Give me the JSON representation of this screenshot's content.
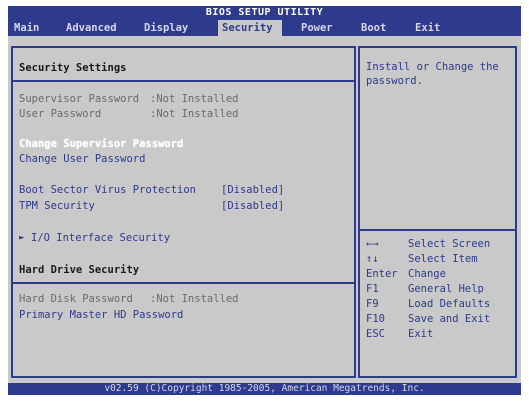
{
  "title": "BIOS SETUP UTILITY",
  "menu": [
    "Main",
    "Advanced",
    "Display",
    "Security",
    "Power",
    "Boot",
    "Exit"
  ],
  "active_menu": "Security",
  "left": {
    "heading": "Security Settings",
    "supervisor_password_label": "Supervisor Password",
    "supervisor_password_value": ":Not Installed",
    "user_password_label": "User Password",
    "user_password_value": ":Not Installed",
    "change_supervisor_password": "Change Supervisor Password",
    "change_user_password": "Change User Password",
    "boot_sector_virus_protection_label": "Boot Sector Virus Protection",
    "boot_sector_virus_protection_value": "[Disabled]",
    "tpm_security_label": "TPM Security",
    "tpm_security_value": "[Disabled]",
    "io_interface_security_marker": "►",
    "io_interface_security": "I/O Interface Security",
    "hard_drive_heading": "Hard Drive Security",
    "hard_disk_password_label": "Hard Disk Password",
    "hard_disk_password_value": ":Not Installed",
    "primary_master_hd_password": "Primary Master HD Password"
  },
  "help": {
    "text_line1": "Install or Change the",
    "text_line2": "password.",
    "keys": [
      {
        "key": "←→",
        "desc": "Select Screen"
      },
      {
        "key": "↑↓",
        "desc": "Select Item"
      },
      {
        "key": "Enter",
        "desc": "Change"
      },
      {
        "key": "F1",
        "desc": "General Help"
      },
      {
        "key": "F9",
        "desc": "Load Defaults"
      },
      {
        "key": "F10",
        "desc": "Save and Exit"
      },
      {
        "key": "ESC",
        "desc": "Exit"
      }
    ]
  },
  "footer": "v02.59 (C)Copyright 1985-2005, American Megatrends, Inc.",
  "colors": {
    "bios_blue": "#2e3a8c",
    "bios_gray": "#c9c9c9",
    "highlight_white": "#ffffff"
  }
}
